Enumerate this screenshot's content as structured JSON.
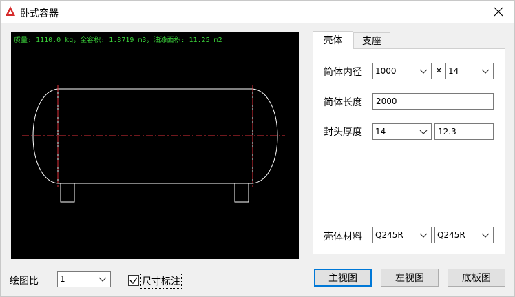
{
  "window": {
    "title": "卧式容器",
    "close_icon": "close-icon",
    "app_icon": "autocad-icon"
  },
  "canvas": {
    "info": "质量: 1110.0 kg，全容积: 1.8719 m3，油漆面积: 11.25 m2",
    "info_color": "#3bd43b"
  },
  "tabs": [
    {
      "label": "壳体",
      "active": true
    },
    {
      "label": "支座",
      "active": false
    }
  ],
  "shell": {
    "inner_diameter_label": "简体内径",
    "inner_diameter_value": "1000",
    "times": "×",
    "thickness_value": "14",
    "length_label": "简体长度",
    "length_value": "2000",
    "head_thickness_label": "封头厚度",
    "head_thickness_value": "14",
    "head_thickness_actual": "12.3",
    "material_label": "壳体材料",
    "material_value": "Q245R",
    "head_material_value": "Q245R"
  },
  "scale": {
    "label": "绘图比",
    "value": "1"
  },
  "dimension": {
    "label": "尺寸标注",
    "checked": true
  },
  "buttons": {
    "front": "主视图",
    "left": "左视图",
    "bottom": "底板图"
  }
}
